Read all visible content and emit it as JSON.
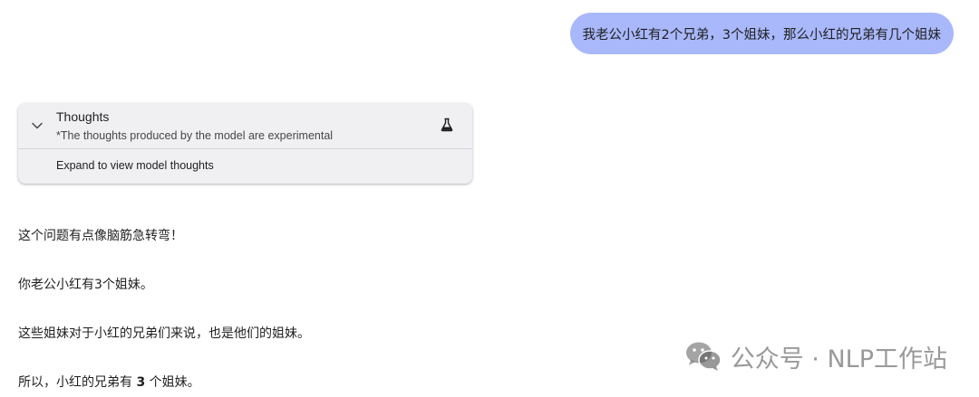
{
  "user_message": {
    "text": "我老公小红有2个兄弟，3个姐妹，那么小红的兄弟有几个姐妹"
  },
  "thoughts": {
    "title": "Thoughts",
    "subtitle": "*The thoughts produced by the model are experimental",
    "expand_label": "Expand to view model thoughts",
    "icons": {
      "toggle": "chevron-down-icon",
      "experimental": "flask-icon"
    }
  },
  "answer": {
    "line1": "这个问题有点像脑筋急转弯！",
    "line2": "你老公小红有3个姐妹。",
    "line3": "这些姐妹对于小红的兄弟们来说，也是他们的姐妹。",
    "line4_prefix": "所以，小红的兄弟有 ",
    "line4_number": "3",
    "line4_suffix": " 个姐妹。"
  },
  "watermark": {
    "text": "公众号 · NLP工作站",
    "icon": "wechat-icon"
  },
  "colors": {
    "user_bubble": "#a9b8fb",
    "card_bg": "#f0f0f3",
    "text": "#1f1f1f"
  }
}
